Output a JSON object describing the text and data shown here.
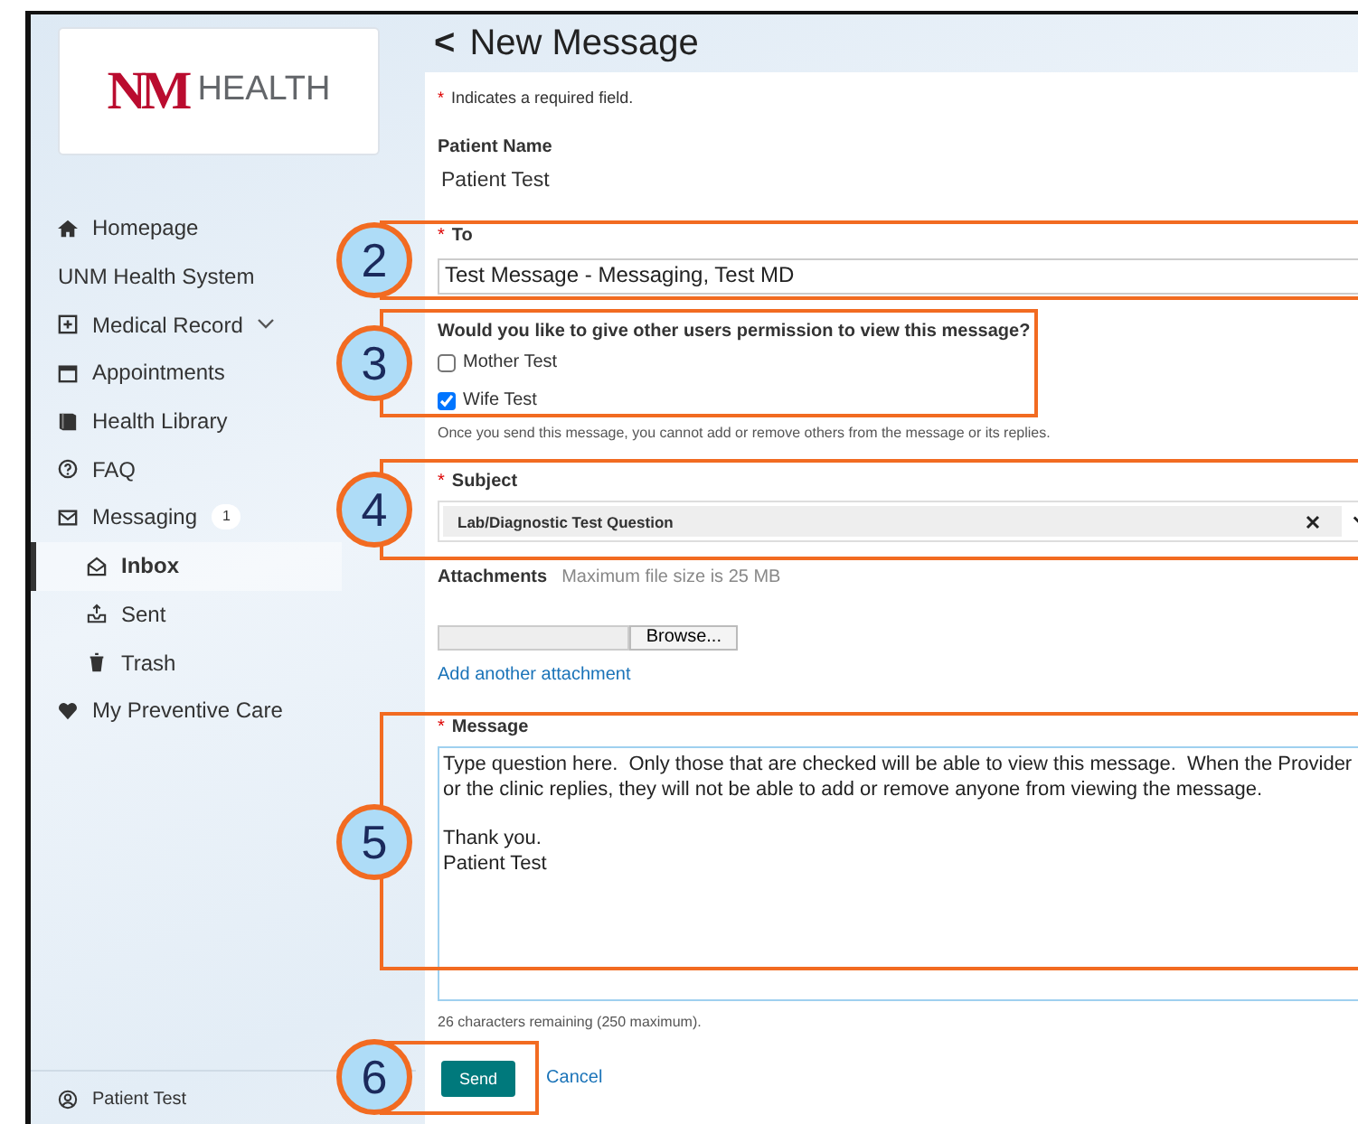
{
  "logo": {
    "mark": "NM",
    "text": "HEALTH"
  },
  "sidebar": {
    "items": [
      {
        "label": "Homepage",
        "selected": false
      },
      {
        "label": "UNM Health System",
        "selected": false
      },
      {
        "label": "Medical Record",
        "selected": false,
        "has_submenu": true
      },
      {
        "label": "Appointments",
        "selected": false
      },
      {
        "label": "Health Library",
        "selected": false
      },
      {
        "label": "FAQ",
        "selected": false
      },
      {
        "label": "Messaging",
        "selected": false,
        "badge": "1",
        "children": [
          {
            "label": "Inbox",
            "selected": true
          },
          {
            "label": "Sent",
            "selected": false
          },
          {
            "label": "Trash",
            "selected": false
          }
        ]
      },
      {
        "label": "My Preventive Care",
        "selected": false
      }
    ],
    "user": "Patient Test"
  },
  "page": {
    "back": "<",
    "title": "New Message"
  },
  "form": {
    "required_mark": "*",
    "required_note": "Indicates a required field.",
    "patient_label": "Patient Name",
    "patient_name": "Patient Test",
    "to": {
      "label": "To",
      "required": true,
      "value": "Test Message - Messaging, Test MD"
    },
    "permission": {
      "question": "Would you like to give other users permission to view this message?",
      "options": [
        {
          "label": "Mother Test",
          "checked": false
        },
        {
          "label": "Wife Test",
          "checked": true
        }
      ],
      "note": "Once you send this message, you cannot add or remove others from the message or its replies."
    },
    "subject": {
      "label": "Subject",
      "required": true,
      "value": "Lab/Diagnostic Test Question"
    },
    "attachments": {
      "label": "Attachments",
      "hint": "Maximum file size is 25 MB",
      "browse": "Browse...",
      "add_link": "Add another attachment"
    },
    "message": {
      "label": "Message",
      "required": true,
      "value": "Type question here.  Only those that are checked will be able to view this message.  When the Provider or the clinic replies, they will not be able to add or remove anyone from viewing the message.\n\nThank you.\nPatient Test"
    },
    "counter": "26 characters remaining (250 maximum).",
    "buttons": [
      {
        "label": "Send",
        "kind": "primary"
      },
      {
        "label": "Cancel",
        "kind": "link"
      }
    ]
  },
  "callouts": [
    {
      "number": "2"
    },
    {
      "number": "3"
    },
    {
      "number": "4"
    },
    {
      "number": "5"
    },
    {
      "number": "6"
    }
  ]
}
